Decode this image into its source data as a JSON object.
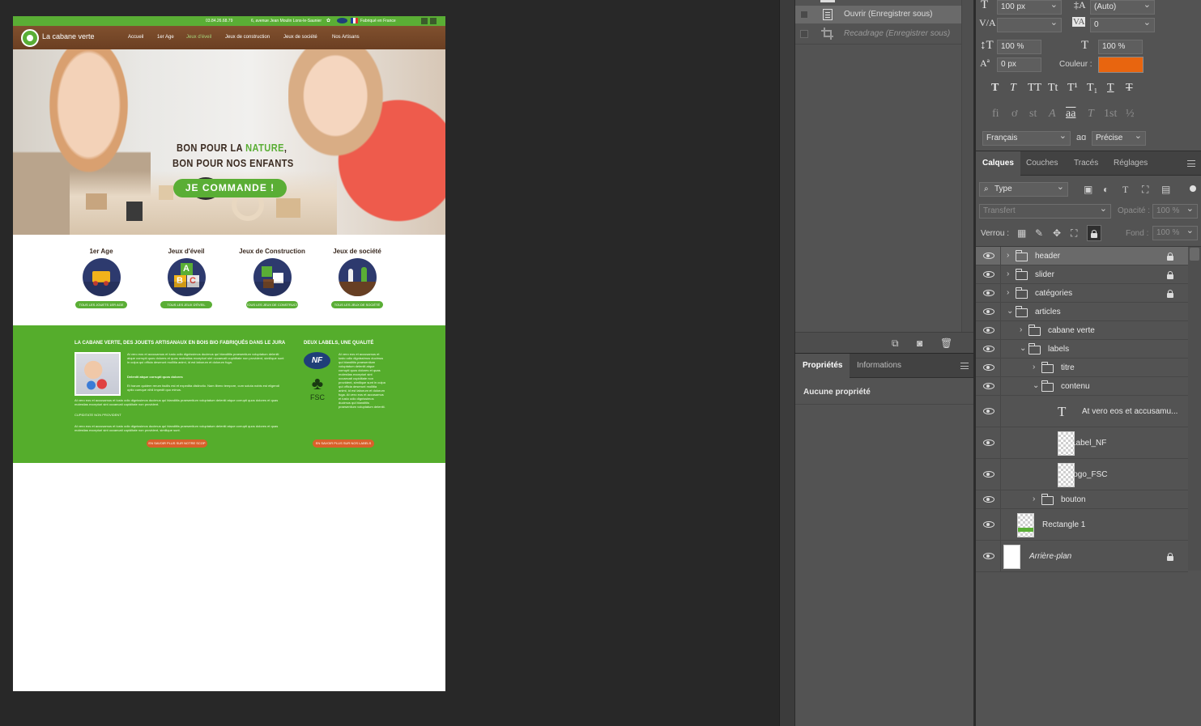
{
  "colors": {
    "accent_green": "#5aae35",
    "brown": "#7a4a2a",
    "swatch_orange": "#e8650f",
    "cta_orange": "#d9602a"
  },
  "canvas": {
    "topbar": {
      "phone": "03.84.26.68.79",
      "address": "6, avenue Jean Moulin Lons-le-Saunier",
      "made_in": "Fabriqué en France"
    },
    "logo_text": "La cabane verte",
    "nav": [
      "Accueil",
      "1er Age",
      "Jeux d'éveil",
      "Jeux de construction",
      "Jeux de société",
      "Nos Artisans"
    ],
    "nav_active_index": 2,
    "hero": {
      "line1_prefix": "BON POUR LA ",
      "line1_highlight": "NATURE",
      "line1_suffix": ",",
      "line2": "BON POUR NOS ENFANTS",
      "cta": "JE COMMANDE !"
    },
    "categories": [
      {
        "title": "1er Age",
        "button": "TOUS LES JOUETS 1ER AGE",
        "icon": "train-icon"
      },
      {
        "title": "Jeux d'éveil",
        "button": "TOUS LES JEUX D'ÉVEIL",
        "icon": "abc-blocks-icon"
      },
      {
        "title": "Jeux de Construction",
        "button": "TOUS LES JEUX DE CONSTRUCTION",
        "icon": "puzzle-icon"
      },
      {
        "title": "Jeux de société",
        "button": "TOUS LES JEUX DE SOCIÉTÉ",
        "icon": "chess-pieces-icon"
      }
    ],
    "band": {
      "title_left": "LA CABANE VERTE, DES JOUETS ARTISANAUX EN BOIS BIO FABRIQUÉS DANS LE JURA",
      "title_right": "DEUX LABELS, UNE QUALITÉ",
      "para1": "At vero eos et accusamus et iusto odio dignissimos ducimus qui blanditiis praesentium voluptatum deleniti atque corrupti quos dolores et quas molestias excepturi sint occaecati cupiditate non provident, similique sunt in culpa qui officia deserunt mollitia animi, id est laborum et dolorum fuga.",
      "subhead": "Deleniti atque corrupti quos dolores",
      "para2": "Et harum quidem rerum facilis est et expedita distinctio. Nam libero tempore, cum soluta nobis est eligendi optio cumque nihil impedit quo minus.",
      "para3": "At vero eos et accusamus et iusto odio dignissimos ducimus qui blanditiis praesentium voluptatum deleniti atque corrupti quos dolores et quas molestias excepturi sint occaecati cupiditate non provident.",
      "subhead2": "CUPIDITATE NON PROVIDENT",
      "para4": "At vero eos et accusamus et iusto odio dignissimos ducimus qui blanditiis praesentium voluptatum deleniti atque corrupti quos dolores et quas molestias excepturi sint occaecati cupiditate non provident, similique sunt.",
      "right_text": "At vero eos et accusamus et iusto odio dignissimos ducimus qui blanditiis praesentium voluptatum deleniti atque corrupti quos dolores et quas molestias excepturi sint occaecati cupiditate non provident, similique sunt in culpa qui officia deserunt mollitia animi, id est laborum et dolorum fuga. At vero eos et accusamus et iusto odio dignissimos ducimus qui blanditiis praesentium voluptatum deleniti.",
      "btn_left": "EN SAVOIR PLUS SUR NOTRE SCOP",
      "btn_right": "EN SAVOIR PLUS SUR NOS LABELS",
      "nf": "NF",
      "fsc": "FSC"
    }
  },
  "history": {
    "items": [
      {
        "label": "Ouvrir (Enregistrer sous)",
        "state": "active"
      },
      {
        "label": "Recadrage (Enregistrer sous)",
        "state": "undone"
      }
    ]
  },
  "properties": {
    "tabs": [
      "Propriétés",
      "Informations"
    ],
    "empty_text": "Aucune propriété"
  },
  "character": {
    "font_size": "100 px",
    "leading": "(Auto)",
    "kerning": "",
    "tracking": "0",
    "vscale": "100 %",
    "hscale": "100 %",
    "baseline": "0 px",
    "color_label": "Couleur :",
    "language": "Français",
    "antialias_label": "aɑ",
    "antialias": "Précise",
    "style_buttons": [
      "T",
      "T",
      "TT",
      "Tt",
      "T¹",
      "T₁",
      "T",
      "T"
    ],
    "opentype_buttons": [
      "fi",
      "ơ",
      "st",
      "A",
      "aa",
      "T",
      "1st",
      "½"
    ]
  },
  "layers": {
    "tabs": [
      "Calques",
      "Couches",
      "Tracés",
      "Réglages"
    ],
    "filter": "Type",
    "blend": "Transfert",
    "opacity_label": "Opacité :",
    "opacity": "100 %",
    "lock_label": "Verrou :",
    "fill_label": "Fond :",
    "fill": "100 %",
    "rows": [
      {
        "name": "header",
        "type": "folder",
        "indent": 0,
        "expanded": false,
        "locked": true,
        "selected": true
      },
      {
        "name": "slider",
        "type": "folder",
        "indent": 0,
        "expanded": false,
        "locked": true
      },
      {
        "name": "catégories",
        "type": "folder",
        "indent": 0,
        "expanded": false,
        "locked": true
      },
      {
        "name": "articles",
        "type": "folder",
        "indent": 0,
        "expanded": true
      },
      {
        "name": "cabane verte",
        "type": "folder",
        "indent": 1,
        "expanded": false
      },
      {
        "name": "labels",
        "type": "folder",
        "indent": 1,
        "expanded": true
      },
      {
        "name": "titre",
        "type": "folder",
        "indent": 2,
        "expanded": false
      },
      {
        "name": "contenu",
        "type": "folder",
        "indent": 2,
        "expanded": true
      },
      {
        "name": "At vero eos et accusamu...",
        "type": "text",
        "indent": 3
      },
      {
        "name": "Label_NF",
        "type": "smart",
        "indent": 3
      },
      {
        "name": "logo_FSC",
        "type": "smart",
        "indent": 3
      },
      {
        "name": "bouton",
        "type": "folder",
        "indent": 2,
        "expanded": false
      },
      {
        "name": "Rectangle 1",
        "type": "shape",
        "indent": 0
      },
      {
        "name": "Arrière-plan",
        "type": "background",
        "indent": 0,
        "locked": true
      }
    ]
  }
}
